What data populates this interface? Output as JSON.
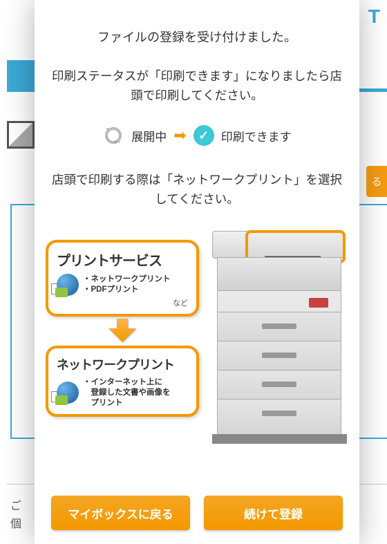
{
  "background": {
    "topRightLetter": "T",
    "orangeBtnPartial": "る",
    "bottomText1": "ご",
    "bottomText2": "個"
  },
  "modal": {
    "line1": "ファイルの登録を受け付けました。",
    "line2": "印刷ステータスが「印刷できます」になりましたら店頭で印刷してください。",
    "status": {
      "expanding": "展開中",
      "ready": "印刷できます"
    },
    "line3": "店頭で印刷する際は「ネットワークプリント」を選択してください。",
    "serviceBox1": {
      "title": "プリントサービス",
      "desc": "・ネットワークプリント\n・PDFプリント",
      "suffix": "など"
    },
    "serviceBox2": {
      "title": "ネットワークプリント",
      "desc": "・インターネット上に\n　登録した文書や画像を\n　プリント"
    },
    "buttons": {
      "back": "マイボックスに戻る",
      "continue": "続けて登録"
    }
  }
}
